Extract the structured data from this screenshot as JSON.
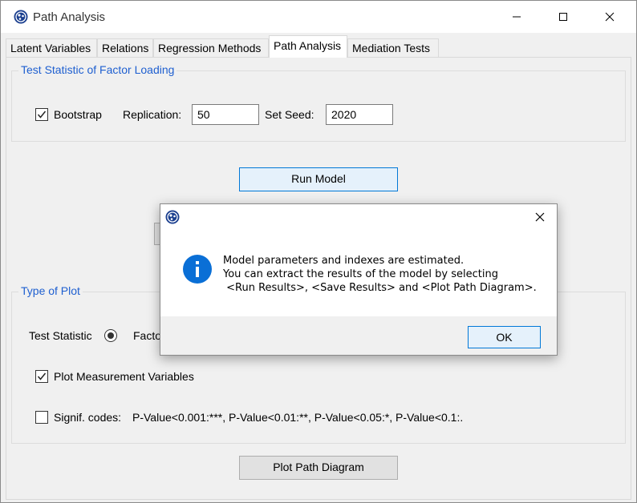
{
  "window": {
    "title": "Path Analysis",
    "controls": {
      "minimize": "—",
      "maximize": "☐",
      "close": "✕"
    }
  },
  "tabs": [
    {
      "label": "Latent Variables",
      "active": false
    },
    {
      "label": "Relations",
      "active": false
    },
    {
      "label": "Regression Methods",
      "active": false
    },
    {
      "label": "Path Analysis",
      "active": true
    },
    {
      "label": "Mediation Tests",
      "active": false
    }
  ],
  "test_statistic_group": {
    "title": "Test Statistic of Factor Loading",
    "bootstrap_label": "Bootstrap",
    "bootstrap_checked": true,
    "replication_label": "Replication:",
    "replication_value": "50",
    "seed_label": "Set Seed:",
    "seed_value": "2020"
  },
  "run_model_button": "Run Model",
  "type_of_plot_group": {
    "title": "Type of Plot",
    "test_statistic_label": "Test Statistic",
    "factor_label_partial": "Facto",
    "plot_measurement_label": "Plot Measurement Variables",
    "plot_measurement_checked": true,
    "signif_label": "Signif. codes:",
    "signif_checked": false,
    "signif_codes": "P-Value<0.001:***, P-Value<0.01:**, P-Value<0.05:*, P-Value<0.1:."
  },
  "plot_path_button": "Plot Path Diagram",
  "dialog": {
    "close": "✕",
    "info_icon": "i",
    "lines": [
      "Model parameters and indexes are estimated.",
      "You can extract the results of the model by selecting",
      " <Run Results>, <Save Results> and <Plot Path Diagram>."
    ],
    "ok_label": "OK"
  },
  "colors": {
    "group_title": "#1e5fd0",
    "info_icon": "#0a6fd6",
    "focus_border": "#0078d7"
  }
}
